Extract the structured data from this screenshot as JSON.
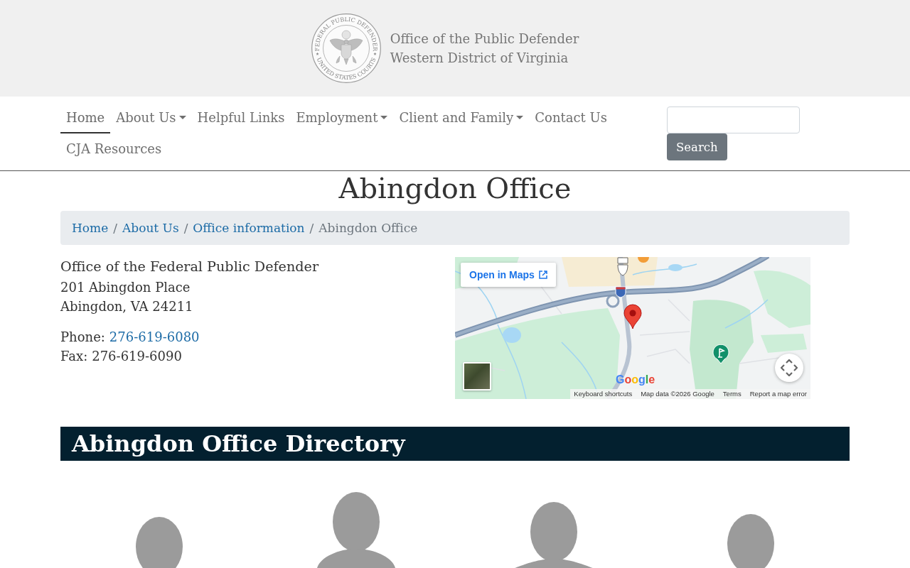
{
  "header": {
    "lines": [
      "Office of the Public Defender",
      "Western District of Virginia"
    ],
    "seal": {
      "top_text": "FEDERAL PUBLIC DEFENDER",
      "bottom_text": "UNITED STATES COURTS"
    }
  },
  "nav": {
    "items": [
      {
        "label": "Home",
        "selected": true,
        "dropdown": false
      },
      {
        "label": "About Us",
        "selected": false,
        "dropdown": true
      },
      {
        "label": "Helpful Links",
        "selected": false,
        "dropdown": false
      },
      {
        "label": "Employment",
        "selected": false,
        "dropdown": true
      },
      {
        "label": "Client and Family",
        "selected": false,
        "dropdown": true
      },
      {
        "label": "Contact Us",
        "selected": false,
        "dropdown": false
      },
      {
        "label": "CJA Resources",
        "selected": false,
        "dropdown": false
      }
    ],
    "search": {
      "button": "Search"
    }
  },
  "page_title": "Abingdon Office",
  "breadcrumb": [
    {
      "label": "Home",
      "current": false
    },
    {
      "label": "About Us",
      "current": false,
      "separator": "/"
    },
    {
      "label": "Office information",
      "current": false,
      "separator": "/"
    },
    {
      "label": "Abingdon Office",
      "current": true,
      "separator": "/"
    }
  ],
  "office": {
    "name": "Office of the Federal Public Defender",
    "address_lines": [
      "201 Abingdon Place",
      "Abingdon, VA 24211"
    ],
    "contacts": [
      {
        "label": "Phone:",
        "value": "276-619-6080",
        "kind": "link"
      },
      {
        "label": "Fax:",
        "value": "276-619-6090",
        "kind": "text"
      }
    ]
  },
  "map": {
    "open_button": "Open in Maps",
    "logo": "Google",
    "footer": [
      "Keyboard shortcuts",
      "Map data ©2026 Google",
      "Terms",
      "Report a map error"
    ]
  },
  "directory": {
    "title": "Abingdon Office Directory"
  }
}
